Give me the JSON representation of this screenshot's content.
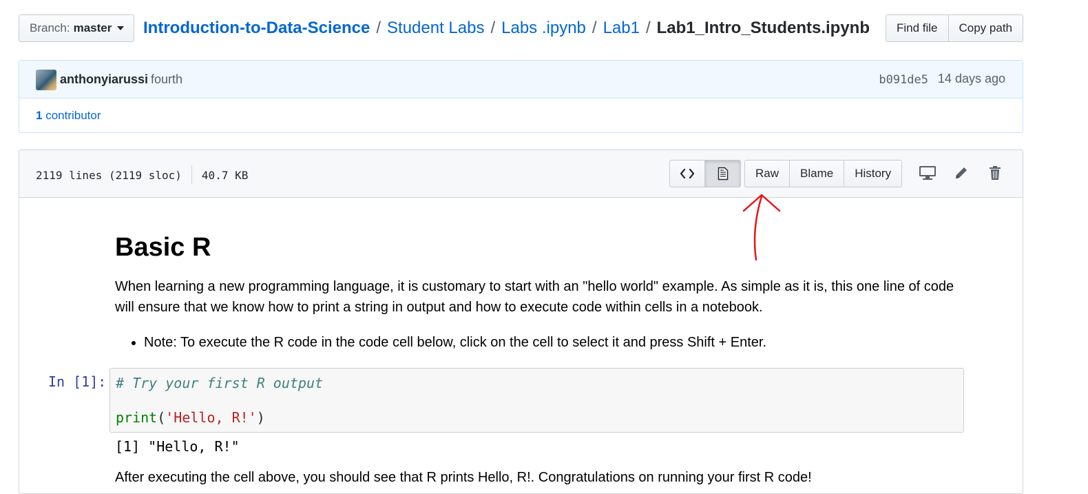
{
  "branch": {
    "label": "Branch:",
    "value": "master"
  },
  "breadcrumb": {
    "items": [
      "Introduction-to-Data-Science",
      "Student Labs",
      "Labs .ipynb",
      "Lab1"
    ],
    "separator": "/",
    "current": "Lab1_Intro_Students.ipynb"
  },
  "file_actions": {
    "find_file": "Find file",
    "copy_path": "Copy path"
  },
  "commit": {
    "author": "anthonyiarussi",
    "message": "fourth",
    "sha": "b091de5",
    "time": "14 days ago"
  },
  "contributors": {
    "count": "1",
    "label": "contributor"
  },
  "file": {
    "lines": "2119 lines (2119 sloc)",
    "size": "40.7 KB",
    "buttons": {
      "raw": "Raw",
      "blame": "Blame",
      "history": "History"
    }
  },
  "notebook": {
    "title": "Basic R",
    "paragraph": "When learning a new programming language, it is customary to start with an \"hello world\" example. As simple as it is, this one line of code will ensure that we know how to print a string in output and how to execute code within cells in a notebook.",
    "note": "Note: To execute the R code in the code cell below, click on the cell to select it and press Shift + Enter.",
    "cell": {
      "prompt": "In [1]:",
      "comment": "# Try your first R output",
      "func": "print",
      "open_paren": "(",
      "string": "'Hello, R!'",
      "close_paren": ")"
    },
    "output": "[1] \"Hello, R!\"",
    "after_text": "After executing the cell above, you should see that R prints Hello, R!. Congratulations on running your first R code!"
  },
  "annotation": {
    "color": "#e8141c"
  }
}
